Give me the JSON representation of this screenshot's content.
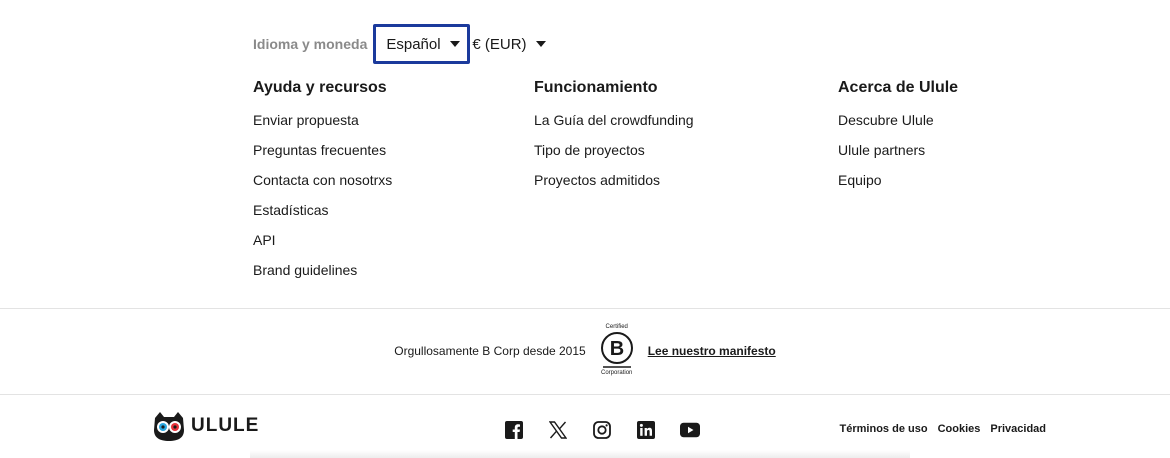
{
  "language_currency": {
    "label": "Idioma y moneda",
    "language_value": "Español",
    "currency_value": "€ (EUR)"
  },
  "columns": [
    {
      "heading": "Ayuda y recursos",
      "links": [
        "Enviar propuesta",
        "Preguntas frecuentes",
        "Contacta con nosotrxs",
        "Estadísticas",
        "API",
        "Brand guidelines"
      ]
    },
    {
      "heading": "Funcionamiento",
      "links": [
        "La Guía del crowdfunding",
        "Tipo de proyectos",
        "Proyectos admitidos"
      ]
    },
    {
      "heading": "Acerca de Ulule",
      "links": [
        "Descubre Ulule",
        "Ulule partners",
        "Equipo"
      ]
    }
  ],
  "bcorp": {
    "text": "Orgullosamente B Corp desde 2015",
    "logo_top": "Certified",
    "logo_letter": "B",
    "logo_bottom": "Corporation",
    "manifesto_link": "Lee nuestro manifesto"
  },
  "footer": {
    "logo_text": "ULULE",
    "socials": [
      "facebook-icon",
      "x-icon",
      "instagram-icon",
      "linkedin-icon",
      "youtube-icon"
    ],
    "legal_links": [
      "Términos de uso",
      "Cookies",
      "Privacidad"
    ]
  },
  "colors": {
    "focus_outline": "#1b3a9c",
    "text": "#1a1a1a",
    "muted_label": "#8a8a8a",
    "divider": "#e3e3e3"
  }
}
